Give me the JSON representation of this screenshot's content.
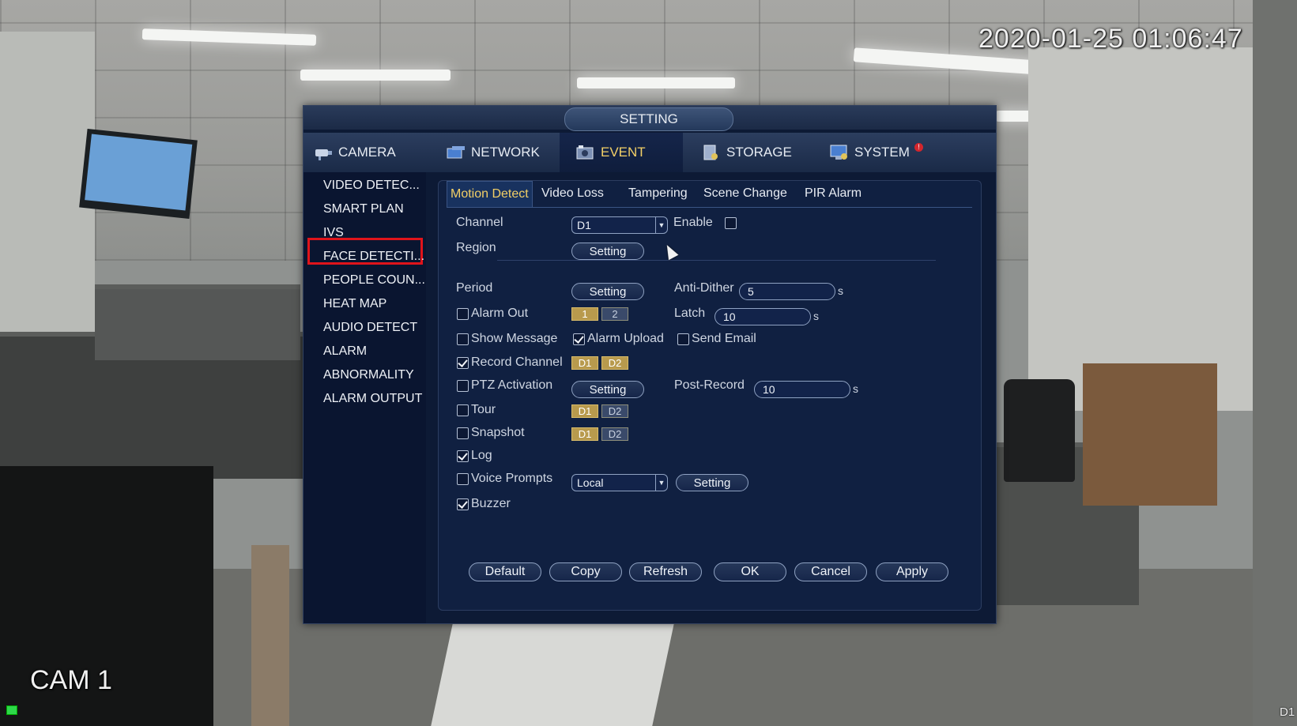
{
  "overlay": {
    "timestamp": "2020-01-25 01:06:47",
    "camera_label": "CAM 1",
    "corner_label": "D1"
  },
  "window": {
    "title": "SETTING",
    "main_tabs": [
      {
        "label": "CAMERA",
        "icon": "camera-icon"
      },
      {
        "label": "NETWORK",
        "icon": "network-icon"
      },
      {
        "label": "EVENT",
        "icon": "event-icon",
        "active": true
      },
      {
        "label": "STORAGE",
        "icon": "storage-icon"
      },
      {
        "label": "SYSTEM",
        "icon": "system-icon",
        "badge": "!"
      }
    ],
    "sidebar": [
      "VIDEO DETEC...",
      "SMART PLAN",
      "IVS",
      "FACE DETECTI...",
      "PEOPLE COUN...",
      "HEAT MAP",
      "AUDIO DETECT",
      "ALARM",
      "ABNORMALITY",
      "ALARM OUTPUT"
    ],
    "sub_tabs": [
      "Motion Detect",
      "Video Loss",
      "Tampering",
      "Scene Change",
      "PIR Alarm"
    ],
    "form": {
      "channel_label": "Channel",
      "channel_value": "D1",
      "enable_label": "Enable",
      "enable_checked": false,
      "region_label": "Region",
      "setting_label": "Setting",
      "period_label": "Period",
      "anti_dither_label": "Anti-Dither",
      "anti_dither_value": "5",
      "seconds_unit": "s",
      "alarm_out_label": "Alarm Out",
      "alarm_out_chip1": "1",
      "alarm_out_chip2": "2",
      "latch_label": "Latch",
      "latch_value": "10",
      "show_message_label": "Show Message",
      "alarm_upload_label": "Alarm Upload",
      "send_email_label": "Send Email",
      "record_channel_label": "Record Channel",
      "ptz_activation_label": "PTZ Activation",
      "post_record_label": "Post-Record",
      "post_record_value": "10",
      "tour_label": "Tour",
      "snapshot_label": "Snapshot",
      "log_label": "Log",
      "voice_prompts_label": "Voice Prompts",
      "voice_prompts_value": "Local",
      "buzzer_label": "Buzzer",
      "chip_d1": "D1",
      "chip_d2": "D2"
    },
    "buttons": [
      "Default",
      "Copy",
      "Refresh",
      "OK",
      "Cancel",
      "Apply"
    ]
  },
  "colors": {
    "window_bg": "#0d1a35",
    "active_tab_text": "#f2cf66",
    "highlight_box": "#e0141b",
    "chip_on": "#b89a4d"
  }
}
